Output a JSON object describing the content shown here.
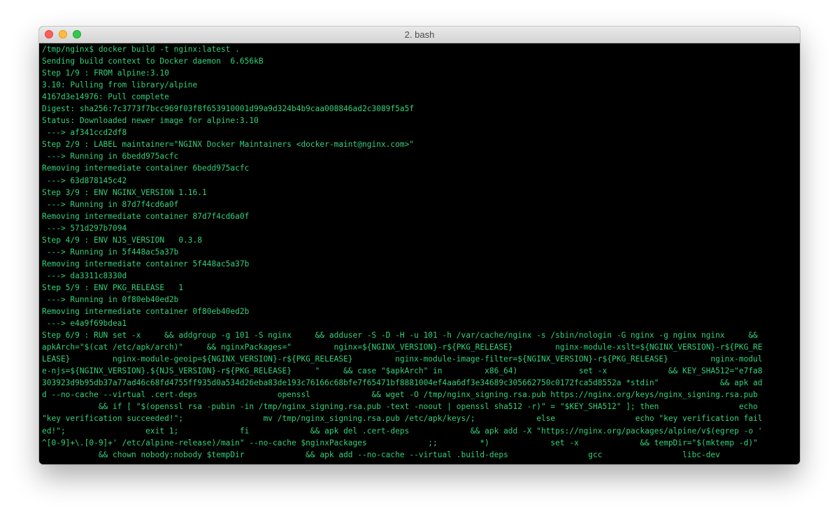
{
  "window": {
    "title": "2. bash"
  },
  "colors": {
    "terminal_bg": "#000000",
    "terminal_fg": "#33d17a",
    "close": "#fc605c",
    "minimize": "#fdbc40",
    "maximize": "#34c84a"
  },
  "terminal": {
    "lines": [
      "/tmp/nginx$ docker build -t nginx:latest .",
      "Sending build context to Docker daemon  6.656kB",
      "Step 1/9 : FROM alpine:3.10",
      "3.10: Pulling from library/alpine",
      "4167d3e14976: Pull complete",
      "Digest: sha256:7c3773f7bcc969f03f8f653910001d99a9d324b4b9caa008846ad2c3089f5a5f",
      "Status: Downloaded newer image for alpine:3.10",
      " ---> af341ccd2df8",
      "Step 2/9 : LABEL maintainer=\"NGINX Docker Maintainers <docker-maint@nginx.com>\"",
      " ---> Running in 6bedd975acfc",
      "Removing intermediate container 6bedd975acfc",
      " ---> 63d878145c42",
      "Step 3/9 : ENV NGINX_VERSION 1.16.1",
      " ---> Running in 87d7f4cd6a0f",
      "Removing intermediate container 87d7f4cd6a0f",
      " ---> 571d297b7094",
      "Step 4/9 : ENV NJS_VERSION   0.3.8",
      " ---> Running in 5f448ac5a37b",
      "Removing intermediate container 5f448ac5a37b",
      " ---> da3311c8330d",
      "Step 5/9 : ENV PKG_RELEASE   1",
      " ---> Running in 0f80eb40ed2b",
      "Removing intermediate container 0f80eb40ed2b",
      " ---> e4a9f69bdea1",
      "Step 6/9 : RUN set -x     && addgroup -g 101 -S nginx     && adduser -S -D -H -u 101 -h /var/cache/nginx -s /sbin/nologin -G nginx -g nginx nginx     &&",
      "apkArch=\"$(cat /etc/apk/arch)\"     && nginxPackages=\"         nginx=${NGINX_VERSION}-r${PKG_RELEASE}         nginx-module-xslt=${NGINX_VERSION}-r${PKG_RE",
      "LEASE}         nginx-module-geoip=${NGINX_VERSION}-r${PKG_RELEASE}         nginx-module-image-filter=${NGINX_VERSION}-r${PKG_RELEASE}         nginx-modul",
      "e-njs=${NGINX_VERSION}.${NJS_VERSION}-r${PKG_RELEASE}     \"     && case \"$apkArch\" in         x86_64)             set -x             && KEY_SHA512=\"e7fa8",
      "303923d9b95db37a77ad46c68fd4755ff935d0a534d26eba83de193c76166c68bfe7f65471bf8881004ef4aa6df3e34689c305662750c0172fca5d8552a *stdin\"             && apk ad",
      "d --no-cache --virtual .cert-deps                 openssl             && wget -O /tmp/nginx_signing.rsa.pub https://nginx.org/keys/nginx_signing.rsa.pub",
      "            && if [ \"$(openssl rsa -pubin -in /tmp/nginx_signing.rsa.pub -text -noout | openssl sha512 -r)\" = \"$KEY_SHA512\" ]; then                 echo",
      "\"key verification succeeded!\";                 mv /tmp/nginx_signing.rsa.pub /etc/apk/keys/;             else                 echo \"key verification fail",
      "ed!\";                 exit 1;             fi             && apk del .cert-deps             && apk add -X \"https://nginx.org/packages/alpine/v$(egrep -o '",
      "^[0-9]+\\.[0-9]+' /etc/alpine-release)/main\" --no-cache $nginxPackages             ;;         *)             set -x             && tempDir=\"$(mktemp -d)\"",
      "            && chown nobody:nobody $tempDir             && apk add --no-cache --virtual .build-deps                 gcc                 libc-dev"
    ]
  }
}
